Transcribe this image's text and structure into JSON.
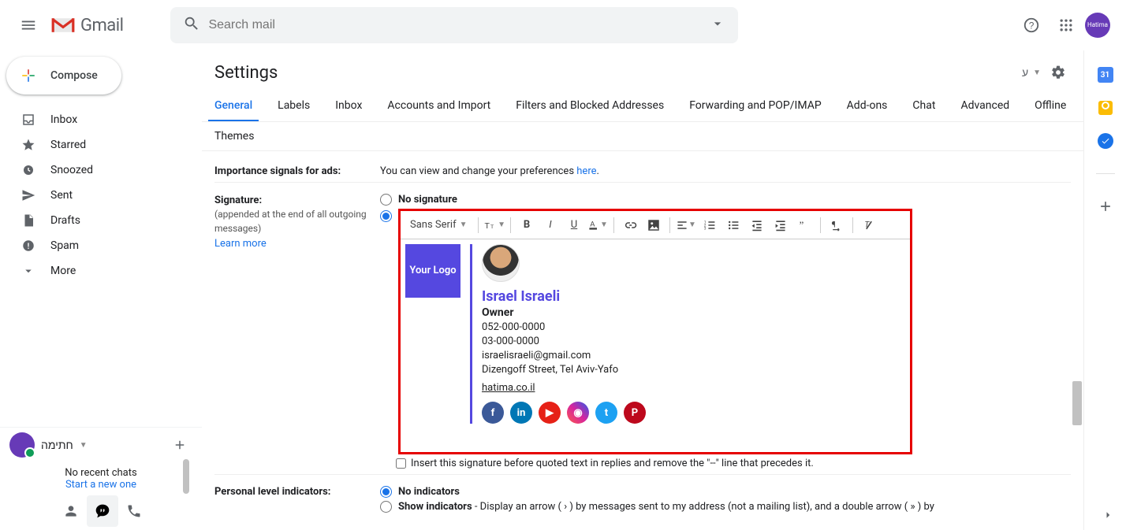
{
  "header": {
    "brand": "Gmail",
    "search_placeholder": "Search mail",
    "avatar_text": "Hatima"
  },
  "sidebar": {
    "compose": "Compose",
    "items": [
      {
        "label": "Inbox"
      },
      {
        "label": "Starred"
      },
      {
        "label": "Snoozed"
      },
      {
        "label": "Sent"
      },
      {
        "label": "Drafts"
      },
      {
        "label": "Spam"
      },
      {
        "label": "More"
      }
    ]
  },
  "hangouts": {
    "user": "חתימה",
    "empty": "No recent chats",
    "start": "Start a new one"
  },
  "settings": {
    "title": "Settings",
    "lang": "ע",
    "tabs": [
      "General",
      "Labels",
      "Inbox",
      "Accounts and Import",
      "Filters and Blocked Addresses",
      "Forwarding and POP/IMAP",
      "Add-ons",
      "Chat",
      "Advanced",
      "Offline"
    ],
    "tab_themes": "Themes"
  },
  "imp": {
    "label": "Importance signals for ads:",
    "text": "You can view and change your preferences ",
    "link": "here"
  },
  "signature": {
    "label": "Signature:",
    "sub": "(appended at the end of all outgoing messages)",
    "learn": "Learn more",
    "no_sig": "No signature",
    "font": "Sans Serif",
    "insert_check": "Insert this signature before quoted text in replies and remove the \"--\" line that precedes it.",
    "logo": "Your Logo",
    "name": "Israel Israeli",
    "role": "Owner",
    "phone1": "052-000-0000",
    "phone2": "03-000-0000",
    "email": "israelisraeli@gmail.com",
    "addr": "Dizengoff Street, Tel Aviv-Yafo",
    "site": "hatima.co.il",
    "socials": {
      "fb": "f",
      "li": "in",
      "yt": "▶",
      "ig": "◉",
      "tw": "t",
      "pn": "P"
    }
  },
  "pli": {
    "label": "Personal level indicators:",
    "noind": "No indicators",
    "show": "Show indicators",
    "showdesc": " - Display an arrow ( › ) by messages sent to my address (not a mailing list), and a double arrow ( » ) by"
  },
  "sidepanel": {
    "cal": "31"
  }
}
